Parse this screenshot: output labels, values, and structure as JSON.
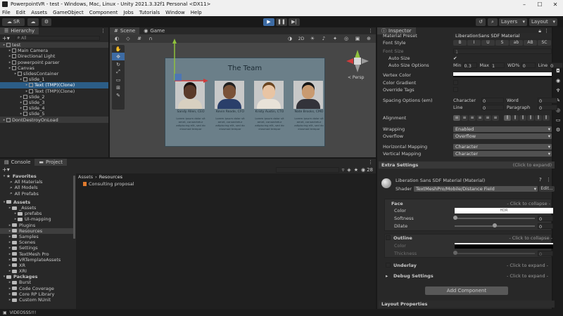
{
  "window": {
    "title": "PowerpointVR - test - Windows, Mac, Linux - Unity 2021.3.32f1 Personal <DX11>"
  },
  "menu": [
    "File",
    "Edit",
    "Assets",
    "GameObject",
    "Component",
    "Jobs",
    "Tutorials",
    "Window",
    "Help"
  ],
  "toolbar": {
    "account": "SR",
    "layers": "Layers",
    "layout": "Layout"
  },
  "hierarchy": {
    "tab": "Hierarchy",
    "search_placeholder": "All",
    "items": [
      {
        "label": "test",
        "depth": 0
      },
      {
        "label": "Main Camera",
        "depth": 1
      },
      {
        "label": "Directional Light",
        "depth": 1
      },
      {
        "label": "powerpoint parser",
        "depth": 1
      },
      {
        "label": "Canvas",
        "depth": 1
      },
      {
        "label": "slidesContainer",
        "depth": 2
      },
      {
        "label": "slide_1",
        "depth": 3
      },
      {
        "label": "Text (TMP)(Clone)",
        "depth": 4
      },
      {
        "label": "Text (TMP)(Clone)",
        "depth": 4
      },
      {
        "label": "slide_2",
        "depth": 3
      },
      {
        "label": "slide_3",
        "depth": 3
      },
      {
        "label": "slide_4",
        "depth": 3
      },
      {
        "label": "slide_5",
        "depth": 3
      },
      {
        "label": "DontDestroyOnLoad",
        "depth": 0
      }
    ]
  },
  "scene": {
    "tabs": [
      "Scene",
      "Game"
    ],
    "slide_title": "The Team",
    "persp": "< Persp",
    "people": [
      {
        "name": "Sandy Allen, CEO"
      },
      {
        "name": "Kevin Reade, CFO"
      },
      {
        "name": "Kristy Austin, CTO"
      },
      {
        "name": "Nate Brooks, CMO"
      }
    ],
    "bio_text": "Lorem ipsum dolor sit amet, consectetur adipiscing elit, sed do eiusmod tempor"
  },
  "console": {
    "tabs": [
      "Console",
      "Project"
    ],
    "count": "28"
  },
  "project": {
    "favorites_label": "Favorites",
    "favorites": [
      "All Materials",
      "All Models",
      "All Prefabs"
    ],
    "assets_label": "Assets",
    "assets": [
      {
        "label": "_Assets",
        "depth": 1
      },
      {
        "label": "prefabs",
        "depth": 2
      },
      {
        "label": "UI-mapping",
        "depth": 2
      },
      {
        "label": "Plugins",
        "depth": 1
      },
      {
        "label": "Resources",
        "depth": 1
      },
      {
        "label": "Samples",
        "depth": 1
      },
      {
        "label": "Scenes",
        "depth": 1
      },
      {
        "label": "Settings",
        "depth": 1
      },
      {
        "label": "TextMesh Pro",
        "depth": 1
      },
      {
        "label": "VRTemplateAssets",
        "depth": 1
      },
      {
        "label": "XR",
        "depth": 1
      },
      {
        "label": "XRI",
        "depth": 1
      }
    ],
    "packages_label": "Packages",
    "packages": [
      "Burst",
      "Code Coverage",
      "Core RP Library",
      "Custom NUnit"
    ],
    "breadcrumb": [
      "Assets",
      "Resources"
    ],
    "files": [
      "Consulting proposal"
    ]
  },
  "inspector": {
    "tab": "Inspector",
    "material_preset_label": "Material Preset",
    "material_preset_value": "LiberationSans SDF Material",
    "font_style_label": "Font Style",
    "font_style_buttons": [
      "B",
      "I",
      "U",
      "S",
      "ab",
      "AB",
      "SC"
    ],
    "font_size_label": "Font Size",
    "font_size_value": "1",
    "auto_size_label": "Auto Size",
    "auto_size_options_label": "Auto Size Options",
    "min_label": "Min",
    "min_value": "0.3",
    "max_label": "Max",
    "max_value": "1",
    "wd_label": "WD%",
    "wd_value": "0",
    "line_label": "Line",
    "line_value": "0",
    "vertex_color_label": "Vertex Color",
    "color_gradient_label": "Color Gradient",
    "override_tags_label": "Override Tags",
    "spacing_label": "Spacing Options (em)",
    "character_label": "Character",
    "character_value": "0",
    "word_label": "Word",
    "word_value": "0",
    "line2_label": "Line",
    "line2_value": "0",
    "paragraph_label": "Paragraph",
    "paragraph_value": "0",
    "alignment_label": "Alignment",
    "wrapping_label": "Wrapping",
    "wrapping_value": "Enabled",
    "overflow_label": "Overflow",
    "overflow_value": "Overflow",
    "hmapping_label": "Horizontal Mapping",
    "hmapping_value": "Character",
    "vmapping_label": "Vertical Mapping",
    "vmapping_value": "Character",
    "extra_settings": "Extra Settings",
    "click_expand": "(Click to expand)",
    "material_name": "Liberation Sans SDF Material (Material)",
    "shader_label": "Shader",
    "shader_value": "TextMeshPro/Mobile/Distance Field",
    "edit_btn": "Edit...",
    "face_label": "Face",
    "click_collapse": "- Click to collapse -",
    "color_label": "Color",
    "hdr_label": "HDR",
    "softness_label": "Softness",
    "softness_value": "0",
    "dilate_label": "Dilate",
    "dilate_value": "0",
    "outline_label": "Outline",
    "outline_color_label": "Color",
    "thickness_label": "Thickness",
    "thickness_value": "0",
    "underlay_label": "Underlay",
    "click_expand2": "- Click to expand -",
    "debug_label": "Debug Settings",
    "add_component": "Add Component",
    "layout_properties": "Layout Properties"
  },
  "taskbar": {
    "text": "VIDEOSSS!!!"
  }
}
